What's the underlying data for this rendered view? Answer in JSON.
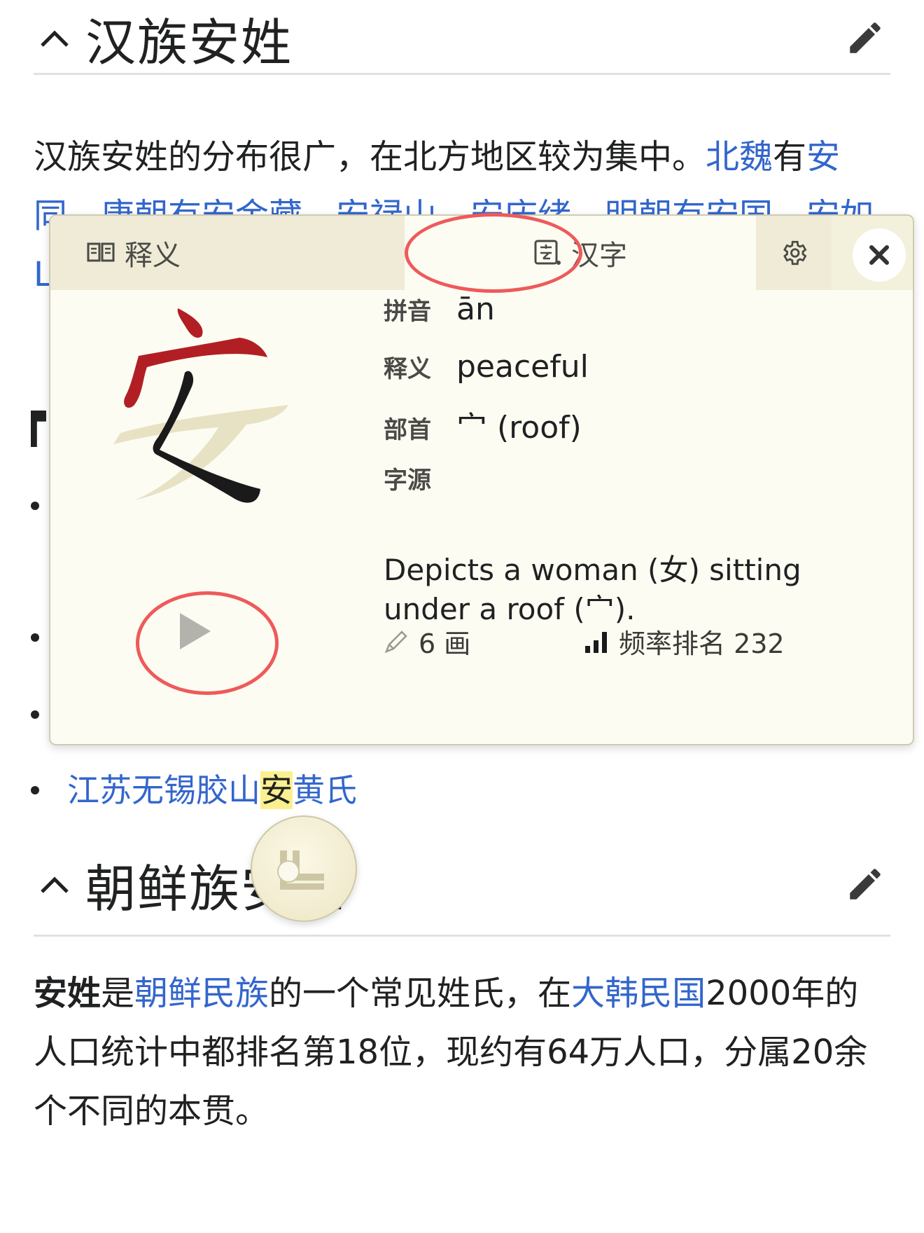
{
  "section1": {
    "title": "汉族安姓",
    "para_line1_text": "汉族安姓的分布很广，在北方地区较为集中。",
    "para_line1_link1": "北魏",
    "para_line1_mid": "有",
    "para_line1_link2": "安",
    "para_line2": "同、唐朝有安金藏、安禄山、安庆绪，明朝有安国、安如",
    "para_line3": "L"
  },
  "bullet_list": {
    "last_item_pre": "江苏无锡胶山",
    "last_item_hl": "安",
    "last_item_post": "黄氏"
  },
  "section2": {
    "title": "朝鲜族安姓",
    "para_bold": "安姓",
    "para_t1": "是",
    "para_link1": "朝鲜民族",
    "para_t2": "的一个常见姓氏，在",
    "para_link2": "大韩民国",
    "para_t3": "2000年的",
    "para_line2": "人口统计中都排名第18位，现约有64万人口，分属20余",
    "para_line3": "个不同的本贯。"
  },
  "popup": {
    "tab_definition": "释义",
    "tab_hanzi": "汉字",
    "character": "安",
    "pinyin_label": "拼音",
    "pinyin_value": "ān",
    "meaning_label": "释义",
    "meaning_value": "peaceful",
    "radical_label": "部首",
    "radical_value": "宀 (roof)",
    "etymology_label": "字源",
    "etymology_text": "Depicts a woman (女) sitting under a roof (宀).",
    "stroke_count": "6 画",
    "frequency": "频率排名 232"
  },
  "colors": {
    "link": "#3366cc",
    "highlight": "#fbf08f",
    "popup_bg": "#fdfcf3",
    "annotation": "#ee5a5a",
    "stroke_red": "#b11f24"
  }
}
